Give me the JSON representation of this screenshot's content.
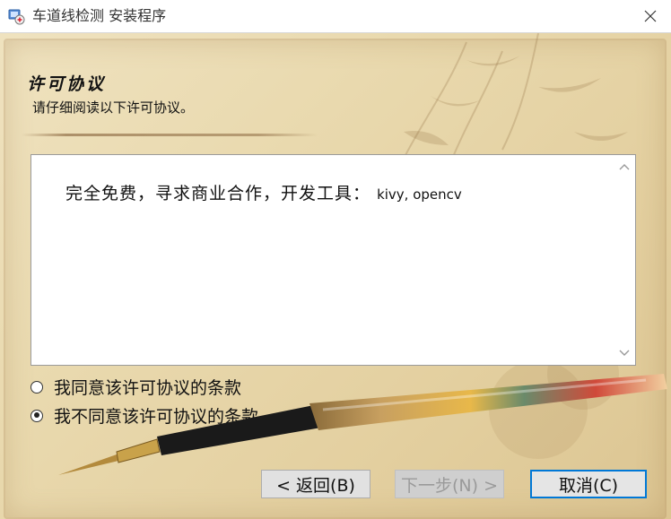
{
  "window": {
    "title": "车道线检测 安装程序",
    "icon": "installer-icon",
    "close_icon": "close-icon"
  },
  "page": {
    "title": "许可协议",
    "subtitle": "请仔细阅读以下许可协议。"
  },
  "license": {
    "text_cn": "完全免费，寻求商业合作，开发工具：",
    "text_latin": "kivy, opencv"
  },
  "options": {
    "accept_label": "我同意该许可协议的条款",
    "decline_label": "我不同意该许可协议的条款",
    "selected": "decline"
  },
  "buttons": {
    "back_label": "< 返回(B)",
    "next_label": "下一步(N) >",
    "cancel_label": "取消(C)"
  },
  "colors": {
    "accent": "#0078d7",
    "parchment": "#e9d9ae"
  }
}
